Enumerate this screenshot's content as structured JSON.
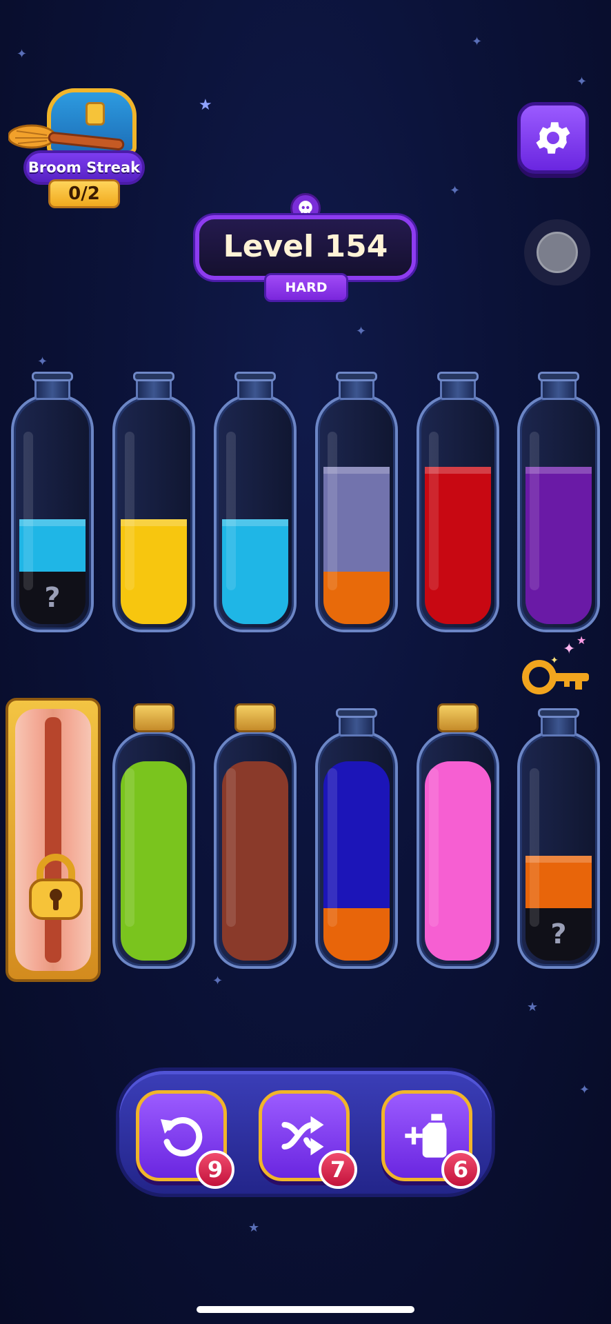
{
  "streak": {
    "title": "Broom Streak",
    "progress": "0/2"
  },
  "level": {
    "title": "Level 154",
    "difficulty": "HARD"
  },
  "bottles": [
    {
      "id": "b1",
      "layers": [
        {
          "color": "#101018",
          "mystery": true
        },
        {
          "color": "#1fb6e6"
        }
      ]
    },
    {
      "id": "b2",
      "layers": [
        {
          "color": "#f7c60f"
        },
        {
          "color": "#f7c60f"
        }
      ]
    },
    {
      "id": "b3",
      "layers": [
        {
          "color": "#1fb6e6"
        },
        {
          "color": "#1fb6e6"
        }
      ]
    },
    {
      "id": "b4",
      "layers": [
        {
          "color": "#e86a0a"
        },
        {
          "color": "#7273ad"
        },
        {
          "color": "#7273ad"
        }
      ]
    },
    {
      "id": "b5",
      "layers": [
        {
          "color": "#c80812"
        },
        {
          "color": "#c80812"
        },
        {
          "color": "#c80812"
        }
      ]
    },
    {
      "id": "b6",
      "layers": [
        {
          "color": "#6a1aa6"
        },
        {
          "color": "#6a1aa6"
        },
        {
          "color": "#6a1aa6"
        }
      ]
    },
    {
      "id": "b7",
      "corked": true,
      "layers": [
        {
          "color": "#7ac41e"
        },
        {
          "color": "#7ac41e"
        },
        {
          "color": "#7ac41e"
        },
        {
          "color": "#7ac41e"
        }
      ]
    },
    {
      "id": "b8",
      "corked": true,
      "layers": [
        {
          "color": "#8a3a2a"
        },
        {
          "color": "#8a3a2a"
        },
        {
          "color": "#8a3a2a"
        },
        {
          "color": "#8a3a2a"
        }
      ]
    },
    {
      "id": "b9",
      "layers": [
        {
          "color": "#e8650a"
        },
        {
          "color": "#1c15b8"
        },
        {
          "color": "#1c15b8"
        },
        {
          "color": "#1c15b8"
        }
      ]
    },
    {
      "id": "b10",
      "corked": true,
      "layers": [
        {
          "color": "#f65fd2"
        },
        {
          "color": "#f65fd2"
        },
        {
          "color": "#f65fd2"
        },
        {
          "color": "#f65fd2"
        }
      ]
    },
    {
      "id": "b11",
      "layers": [
        {
          "color": "#101018",
          "mystery": true
        },
        {
          "color": "#e8650a"
        }
      ]
    }
  ],
  "mystery_mark": "?",
  "tools": {
    "undo": {
      "count": "9",
      "icon": "undo-icon"
    },
    "shuffle": {
      "count": "7",
      "icon": "shuffle-icon"
    },
    "add_bottle": {
      "count": "6",
      "icon": "add-bottle-icon"
    }
  },
  "colors": {
    "accent": "#7a2ed8",
    "gold": "#f1b52a",
    "badge": "#d3193f"
  }
}
